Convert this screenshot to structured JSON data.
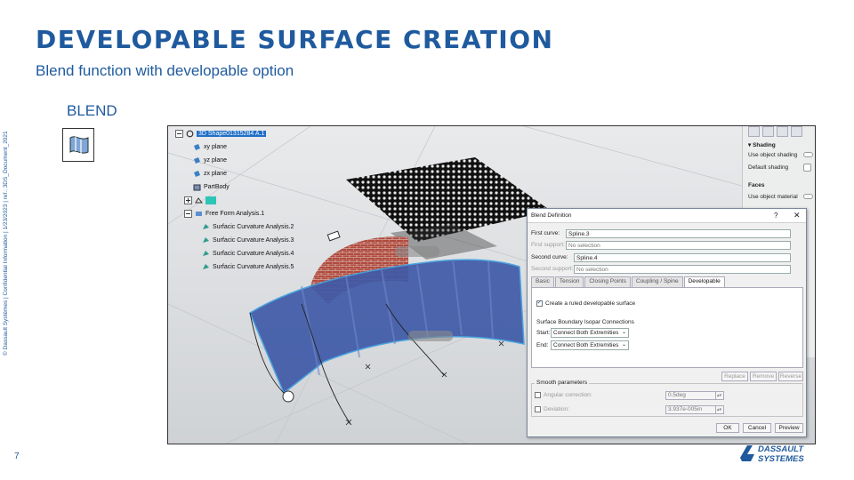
{
  "slide": {
    "title": "DEVELOPABLE SURFACE CREATION",
    "subtitle": "Blend function with developable option",
    "side_note": "© Dassault Systèmes | Confidential Information | 1/23/2023 | ref.: 3DS_Document_2021",
    "page_number": "7",
    "section_label": "BLEND"
  },
  "tree": {
    "root": "3D Shape01315284 A.1",
    "items": [
      "xy plane",
      "yz plane",
      "zx plane",
      "PartBody",
      "",
      "Free Form Analysis.1"
    ],
    "analyses": [
      "Surfacic Curvature Analysis.2",
      "Surfacic Curvature Analysis.3",
      "Surfacic Curvature Analysis.4",
      "Surfacic Curvature Analysis.5"
    ]
  },
  "right_panel": {
    "shading_header": "Shading",
    "use_object_shading": "Use object shading",
    "default_shading": "Default shading",
    "faces_header": "Faces",
    "use_object_material": "Use object material"
  },
  "dialog": {
    "title": "Blend Definition",
    "help": "?",
    "close": "✕",
    "first_curve_label": "First curve:",
    "first_curve_value": "Spline.3",
    "first_support_label": "First support:",
    "first_support_value": "No selection",
    "second_curve_label": "Second curve:",
    "second_curve_value": "Spline.4",
    "second_support_label": "Second support:",
    "second_support_value": "No selection",
    "tabs": [
      "Basic",
      "Tension",
      "Closing Points",
      "Coupling / Spine",
      "Developable"
    ],
    "active_tab": "Developable",
    "ruled_checkbox": "Create a ruled developable surface",
    "boundary_header": "Surface Boundary Isopar Connections",
    "start_label": "Start:",
    "start_value": "Connect Both Extremities",
    "end_label": "End:",
    "end_value": "Connect Both Extremities",
    "replace": "Replace",
    "remove": "Remove",
    "reverse": "Reverse",
    "smooth_header": "Smooth parameters",
    "angular_label": "Angular correction:",
    "angular_value": "0.5deg",
    "deviation_label": "Deviation:",
    "deviation_value": "3.937e-005in",
    "ok": "OK",
    "cancel": "Cancel",
    "preview": "Preview"
  },
  "logo": {
    "line1": "DASSAULT",
    "line2": "SYSTEMES"
  },
  "colors": {
    "brand_blue": "#1f5a9e",
    "surface_blue": "#3f5aa8",
    "selection_cyan": "#2ec4b6"
  }
}
